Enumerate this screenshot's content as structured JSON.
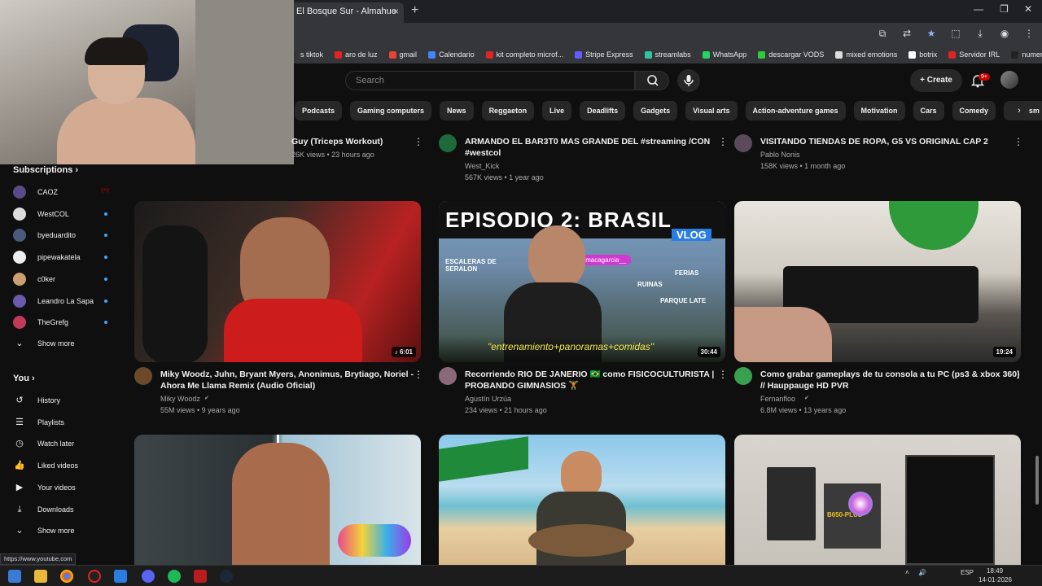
{
  "browser": {
    "tab_title": "El Bosque Sur - Almahue",
    "tab_close": "×",
    "new_tab": "+",
    "status_url": "https://www.youtube.com"
  },
  "bookmarks": [
    {
      "label": "s tiktok",
      "color": "#333333"
    },
    {
      "label": "aro de luz",
      "color": "#e02424"
    },
    {
      "label": "gmail",
      "color": "#ea4335"
    },
    {
      "label": "Calendario",
      "color": "#4285f4"
    },
    {
      "label": "kit completo microf...",
      "color": "#e02424"
    },
    {
      "label": "Stripe Express",
      "color": "#635bff"
    },
    {
      "label": "streamlabs",
      "color": "#31c3a2"
    },
    {
      "label": "WhatsApp",
      "color": "#25d366"
    },
    {
      "label": "descargar VODS",
      "color": "#2ecc40"
    },
    {
      "label": "mixed emotions",
      "color": "#dddddd"
    },
    {
      "label": "botrix",
      "color": "#ffffff"
    },
    {
      "label": "Servidor IRL",
      "color": "#e02424"
    },
    {
      "label": "numeris shoes",
      "color": "#222222"
    }
  ],
  "masthead": {
    "search_placeholder": "Search",
    "create_label": "Create",
    "notif_badge": "9+"
  },
  "chips": [
    "Podcasts",
    "Gaming computers",
    "News",
    "Reggaeton",
    "Live",
    "Deadlifts",
    "Gadgets",
    "Visual arts",
    "Action-adventure games",
    "Motivation",
    "Cars",
    "Comedy",
    "Tourism"
  ],
  "sidebar": {
    "subscriptions_title": "Subscriptions",
    "subscriptions": [
      {
        "name": "CAOZ",
        "color": "#5a4a8a",
        "status": "live"
      },
      {
        "name": "WestCOL",
        "color": "#dddddd",
        "status": "dot"
      },
      {
        "name": "byeduardito",
        "color": "#4a5a7a",
        "status": "dot"
      },
      {
        "name": "pipewakatela",
        "color": "#eeeeee",
        "status": "dot"
      },
      {
        "name": "c0ker",
        "color": "#caa070",
        "status": "dot"
      },
      {
        "name": "Leandro La Sapa",
        "color": "#6a5aa8",
        "status": "dot"
      },
      {
        "name": "TheGrefg",
        "color": "#c23a5a",
        "status": "dot"
      }
    ],
    "subs_show_more": "Show more",
    "you_title": "You",
    "you_items": [
      {
        "label": "History",
        "icon": "history-icon",
        "glyph": "↺"
      },
      {
        "label": "Playlists",
        "icon": "playlists-icon",
        "glyph": "☰"
      },
      {
        "label": "Watch later",
        "icon": "watch-later-icon",
        "glyph": "◷"
      },
      {
        "label": "Liked videos",
        "icon": "like-icon",
        "glyph": "👍"
      },
      {
        "label": "Your videos",
        "icon": "your-videos-icon",
        "glyph": "▶"
      },
      {
        "label": "Downloads",
        "icon": "download-icon",
        "glyph": "⤓"
      }
    ],
    "you_show_more": "Show more"
  },
  "row1": [
    {
      "title1": "Guy (Triceps Workout)",
      "title2": "",
      "channel": "",
      "meta": "26K views • 23 hours ago"
    },
    {
      "title1": "ARMANDO EL BAR3T0 MAS GRANDE DEL #streaming /CON",
      "title2": "#westcol",
      "channel": "West_Kick",
      "meta": "567K views • 1 year ago"
    },
    {
      "title1": "VISITANDO TIENDAS DE ROPA, G5 VS ORIGINAL CAP 2",
      "title2": "",
      "channel": "Pablo Nonis",
      "meta": "158K views • 1 month ago"
    }
  ],
  "row2": [
    {
      "title1": "Miky Woodz, Juhn, Bryant Myers, Anonimus, Brytiago, Noriel -",
      "title2": "Ahora Me Llama Remix (Audio Oficial)",
      "channel": "Miky Woodz",
      "meta": "55M views • 9 years ago",
      "duration": "♪ 6:01",
      "verified": true
    },
    {
      "title1": "Recorriendo RIO DE JANERIO 🇧🇷 como FISICOCULTURISTA |",
      "title2": "PROBANDO GIMNASIOS 🏋",
      "channel": "Agustín Urzúa",
      "meta": "234 views • 21 hours ago",
      "duration": "30:44",
      "verified": false
    },
    {
      "title1": "Como grabar gameplays de tu consola a tu PC (ps3 & xbox 360)",
      "title2": "// Hauppauge HD PVR",
      "channel": "Fernanfloo",
      "meta": "6.8M views • 13 years ago",
      "duration": "19:24",
      "verified": true
    }
  ],
  "thumb_text": {
    "ep_title": "EPISODIO 2: BRASIL",
    "ep_vlog": "VLOG",
    "ep_handle": "@macagarcia__",
    "ep_loc1": "ESCALERAS DE SERALON",
    "ep_loc2": "FERIAS",
    "ep_loc3": "RUINAS",
    "ep_loc4": "PARQUE LATE",
    "ep_caption": "\"entrenamiento+panoramas+comidas\"",
    "pc_label": "B650-PLUS"
  },
  "taskbar": {
    "lang": "ESP",
    "time": "18:49",
    "date": "14-01-2026"
  }
}
